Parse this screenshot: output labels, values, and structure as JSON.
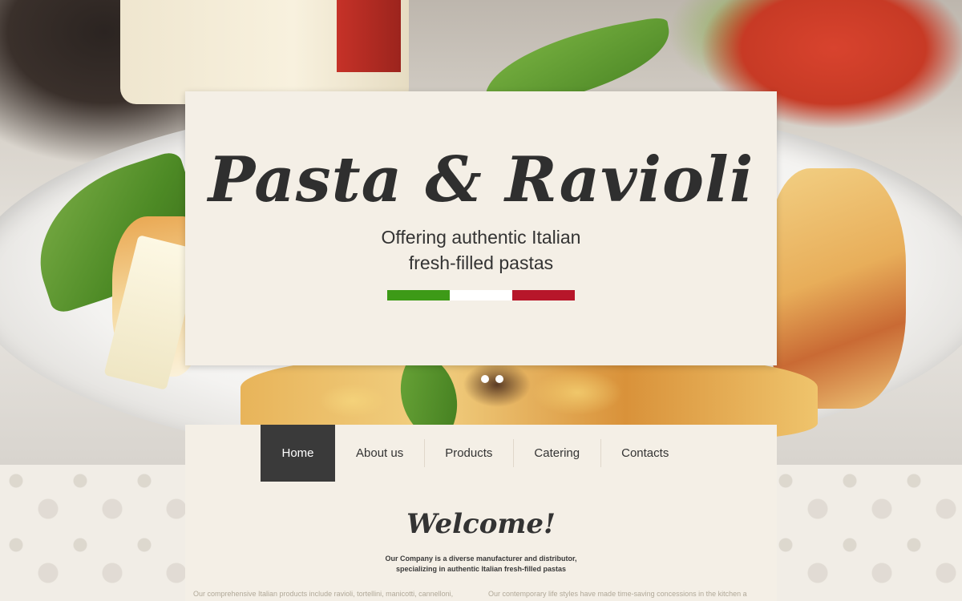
{
  "hero": {
    "title": "Pasta & Ravioli",
    "subtitle_line1": "Offering authentic Italian",
    "subtitle_line2": "fresh-filled pastas",
    "flag_colors": [
      "#3d9a17",
      "#ffffff",
      "#b7162a"
    ],
    "slider_dots": 3,
    "active_slide": 2
  },
  "nav": {
    "items": [
      {
        "label": "Home",
        "active": true
      },
      {
        "label": "About us",
        "active": false
      },
      {
        "label": "Products",
        "active": false
      },
      {
        "label": "Catering",
        "active": false
      },
      {
        "label": "Contacts",
        "active": false
      }
    ],
    "active_bg": "#3a3a3a"
  },
  "welcome": {
    "heading": "Welcome!",
    "intro_line1": "Our Company is a diverse manufacturer and distributor,",
    "intro_line2": "specializing in authentic Italian fresh-filled pastas",
    "col1": "Our comprehensive Italian products include ravioli, tortellini, manicotti, cannelloni,",
    "col2": "Our contemporary life styles have made time-saving concessions in the kitchen a"
  }
}
